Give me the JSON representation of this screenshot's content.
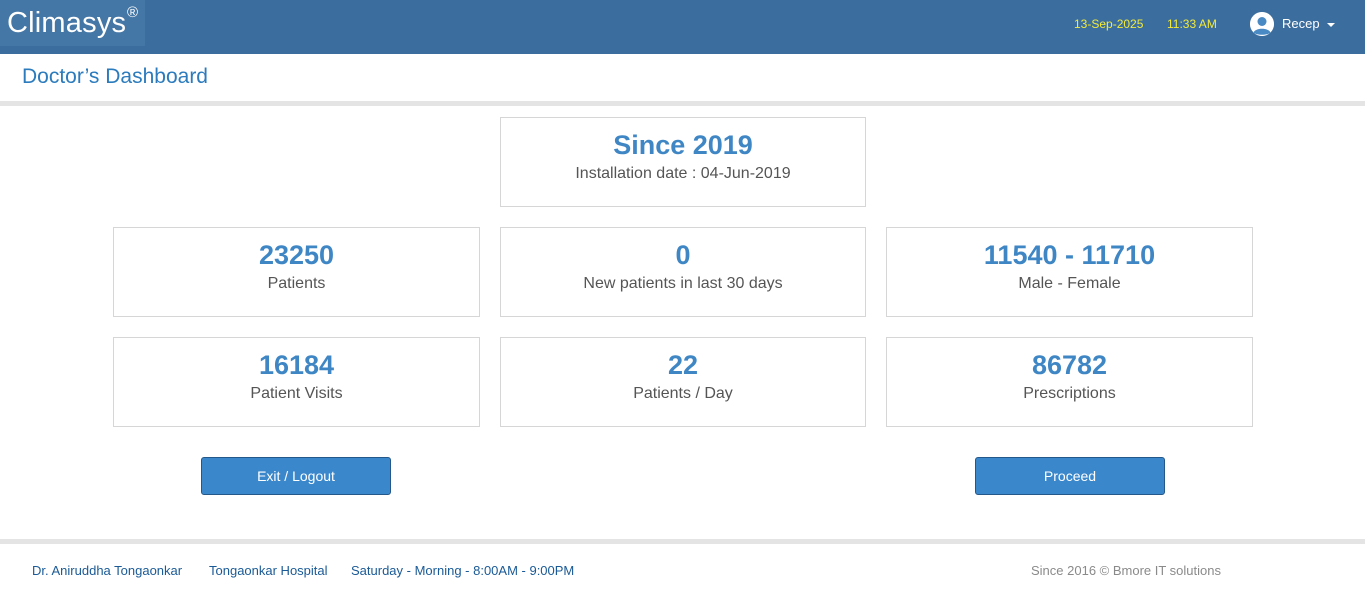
{
  "header": {
    "brand": "Climasys",
    "brand_mark": "®",
    "date": "13-Sep-2025",
    "time": "11:33 AM",
    "user": "Recep",
    "colors": {
      "bar": "#3b6e9e",
      "date_time": "#f3ea3a"
    }
  },
  "page": {
    "title": "Doctor’s Dashboard"
  },
  "since": {
    "value": "Since 2019",
    "label": "Installation date : 04-Jun-2019"
  },
  "stats": {
    "patients": {
      "value": "23250",
      "label": "Patients"
    },
    "new_patients": {
      "value": "0",
      "label": "New patients in last 30 days"
    },
    "gender": {
      "value": "11540 - 11710",
      "label": "Male - Female"
    },
    "visits": {
      "value": "16184",
      "label": "Patient Visits"
    },
    "per_day": {
      "value": "22",
      "label": "Patients / Day"
    },
    "prescriptions": {
      "value": "86782",
      "label": "Prescriptions"
    }
  },
  "actions": {
    "exit": "Exit / Logout",
    "proceed": "Proceed"
  },
  "footer": {
    "doctor": "Dr. Aniruddha Tongaonkar",
    "hospital": "Tongaonkar Hospital",
    "schedule": "Saturday - Morning - 8:00AM - 9:00PM",
    "copyright": "Since 2016 © Bmore IT solutions"
  },
  "icons": [
    "user-avatar-icon",
    "caret-down-icon"
  ]
}
